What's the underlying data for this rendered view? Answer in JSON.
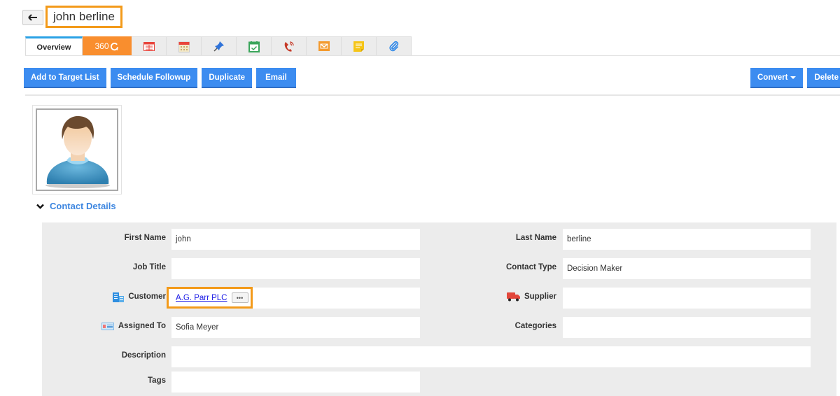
{
  "header": {
    "back_icon": "arrow-left-icon",
    "title": "john berline"
  },
  "tabs": [
    {
      "id": "overview",
      "label": "Overview",
      "icon": null,
      "active": true
    },
    {
      "id": "360",
      "label": "360",
      "icon": "refresh-360-icon",
      "color": "#f98e2e"
    },
    {
      "id": "details",
      "label": "",
      "icon": "table-card-icon",
      "color": "#e8453c"
    },
    {
      "id": "calendar",
      "label": "",
      "icon": "calendar-icon",
      "color": "#e8453c"
    },
    {
      "id": "pin",
      "label": "",
      "icon": "pushpin-icon",
      "color": "#2f73d9"
    },
    {
      "id": "tasks",
      "label": "",
      "icon": "calendar-check-icon",
      "color": "#3aa55b"
    },
    {
      "id": "calls",
      "label": "",
      "icon": "phone-call-icon",
      "color": "#c63a28"
    },
    {
      "id": "emails",
      "label": "",
      "icon": "envelope-icon",
      "color": "#f39a2e"
    },
    {
      "id": "notes",
      "label": "",
      "icon": "sticky-note-icon",
      "color": "#f5c518"
    },
    {
      "id": "attachments",
      "label": "",
      "icon": "paperclip-icon",
      "color": "#2c86e8"
    }
  ],
  "actions": {
    "left": [
      "Add to Target List",
      "Schedule Followup",
      "Duplicate",
      "Email"
    ],
    "convert": "Convert",
    "delete": "Delete"
  },
  "section": {
    "title": "Contact Details",
    "collapse_icon": "chevron-down-icon"
  },
  "fields": {
    "first_name": {
      "label": "First Name",
      "value": "john"
    },
    "last_name": {
      "label": "Last Name",
      "value": "berline"
    },
    "job_title": {
      "label": "Job Title",
      "value": ""
    },
    "contact_type": {
      "label": "Contact Type",
      "value": "Decision Maker"
    },
    "customer": {
      "label": "Customer",
      "value": "A.G. Parr PLC",
      "more": "•••",
      "icon": "building-icon"
    },
    "supplier": {
      "label": "Supplier",
      "value": "",
      "icon": "truck-icon"
    },
    "assigned_to": {
      "label": "Assigned To",
      "value": "Sofia Meyer",
      "icon": "id-card-icon"
    },
    "categories": {
      "label": "Categories",
      "value": ""
    },
    "description": {
      "label": "Description",
      "value": ""
    },
    "tags": {
      "label": "Tags",
      "value": ""
    }
  },
  "colors": {
    "accent_blue": "#3c8cf0",
    "highlight_orange": "#f39a1a",
    "tab_360": "#f98e2e",
    "section_title": "#3d86e0"
  }
}
